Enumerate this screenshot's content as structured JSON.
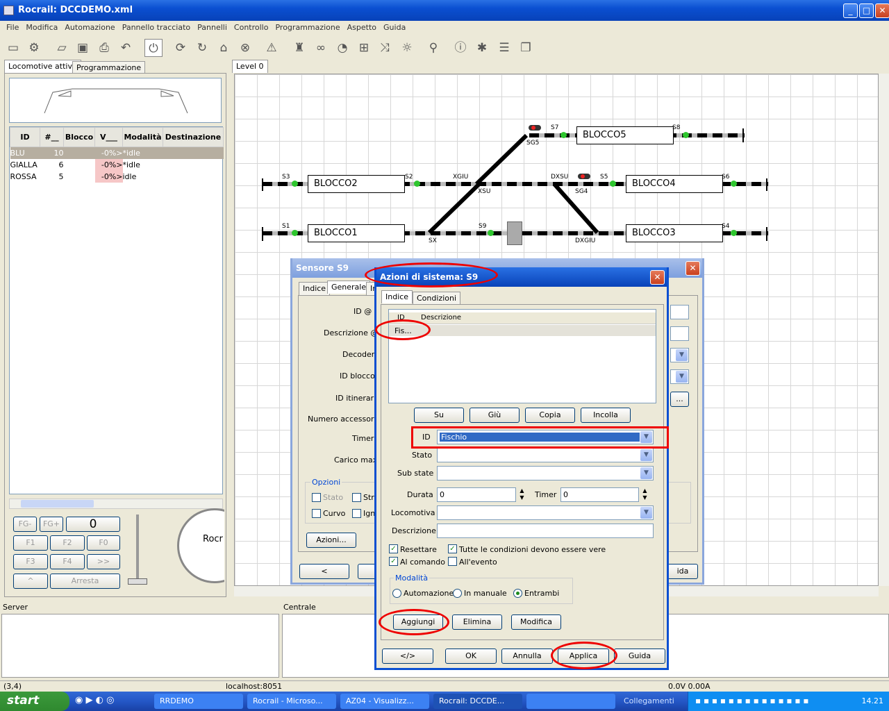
{
  "window": {
    "title": "Rocrail: DCCDEMO.xml",
    "min": "_",
    "max": "□",
    "close": "✕"
  },
  "menu": [
    "File",
    "Modifica",
    "Automazione",
    "Pannello tracciato",
    "Pannelli",
    "Controllo",
    "Programmazione",
    "Aspetto",
    "Guida"
  ],
  "left_tabs": [
    "Locomotive attive",
    "Programmazione"
  ],
  "loco_table": {
    "headers": [
      "ID",
      "#__",
      "Blocco",
      "V___",
      "Modalità",
      "Destinazione"
    ],
    "rows": [
      [
        "BLU",
        "10",
        "",
        "-0%>",
        "*idle",
        ""
      ],
      [
        "GIALLA",
        "6",
        "",
        "-0%>",
        "*idle",
        ""
      ],
      [
        "ROSSA",
        "5",
        "",
        "-0%>",
        "idle",
        ""
      ]
    ]
  },
  "throttle": {
    "fg_minus": "FG-",
    "fg_plus": "FG+",
    "speed": "0",
    "f1": "F1",
    "f2": "F2",
    "f0": "F0",
    "f3": "F3",
    "f4": "F4",
    "more": ">>",
    "up": "^",
    "stop": "Arresta",
    "clock_brand": "Rocr"
  },
  "plan_tab": "Level 0",
  "plan": {
    "blocks": [
      "BLOCCO5",
      "BLOCCO2",
      "BLOCCO4",
      "BLOCCO1",
      "BLOCCO3"
    ],
    "labels": {
      "s7": "S7",
      "s8": "S8",
      "sg5": "SG5",
      "s3": "S3",
      "s2": "S2",
      "xgiu": "XGIU",
      "dxsu": "DXSU",
      "s5": "S5",
      "s6": "S6",
      "xsu": "XSU",
      "sg4": "SG4",
      "s1": "S1",
      "s9": "S9",
      "s4": "S4",
      "sx": "SX",
      "dxgiu": "DXGIU"
    }
  },
  "sensor_dialog": {
    "title": "Sensore S9",
    "tabs": [
      "Indice",
      "Generale",
      "In"
    ],
    "fields": [
      "ID @",
      "Descrizione @",
      "Decoder",
      "ID blocco",
      "ID itinerari",
      "Numero accessorio",
      "Timer",
      "Carico max"
    ],
    "options_label": "Opzioni",
    "opts": [
      "Stato",
      "Stra",
      "Curvo",
      "Ign"
    ],
    "actions_btn": "Azioni...",
    "prev": "<",
    "help": "ida",
    "dots": "..."
  },
  "actions_dialog": {
    "title": "Azioni di sistema: S9",
    "tabs": [
      "Indice",
      "Condizioni"
    ],
    "list_headers": [
      "ID",
      "Descrizione"
    ],
    "list_rows": [
      "Fis..."
    ],
    "btn_su": "Su",
    "btn_giu": "Giù",
    "btn_copia": "Copia",
    "btn_incolla": "Incolla",
    "id_label": "ID",
    "id_value": "Fischio",
    "stato_label": "Stato",
    "substate_label": "Sub state",
    "durata_label": "Durata",
    "durata_value": "0",
    "timer_label": "Timer",
    "timer_value": "0",
    "loco_label": "Locomotiva",
    "desc_label": "Descrizione",
    "chk_reset": "Resettare",
    "chk_all": "Tutte le condizioni devono essere vere",
    "chk_cmd": "Al comando",
    "chk_event": "All'evento",
    "mode_label": "Modalità",
    "mode_auto": "Automazione",
    "mode_manual": "In manuale",
    "mode_both": "Entrambi",
    "btn_add": "Aggiungi",
    "btn_del": "Elimina",
    "btn_mod": "Modifica",
    "btn_xml": "</>",
    "btn_ok": "OK",
    "btn_cancel": "Annulla",
    "btn_apply": "Applica",
    "btn_help": "Guida"
  },
  "bottom": {
    "server": "Server",
    "centrale": "Centrale"
  },
  "status": {
    "coord": "(3,4)",
    "host": "localhost:8051",
    "power": "0.0V 0.00A"
  },
  "taskbar": {
    "start": "start",
    "tasks": [
      "RRDEMO",
      "Rocrail - Microso...",
      "AZ04 - Visualizz...",
      "Rocrail: DCCDE...",
      ""
    ],
    "links": "Collegamenti",
    "time": "14.21"
  }
}
